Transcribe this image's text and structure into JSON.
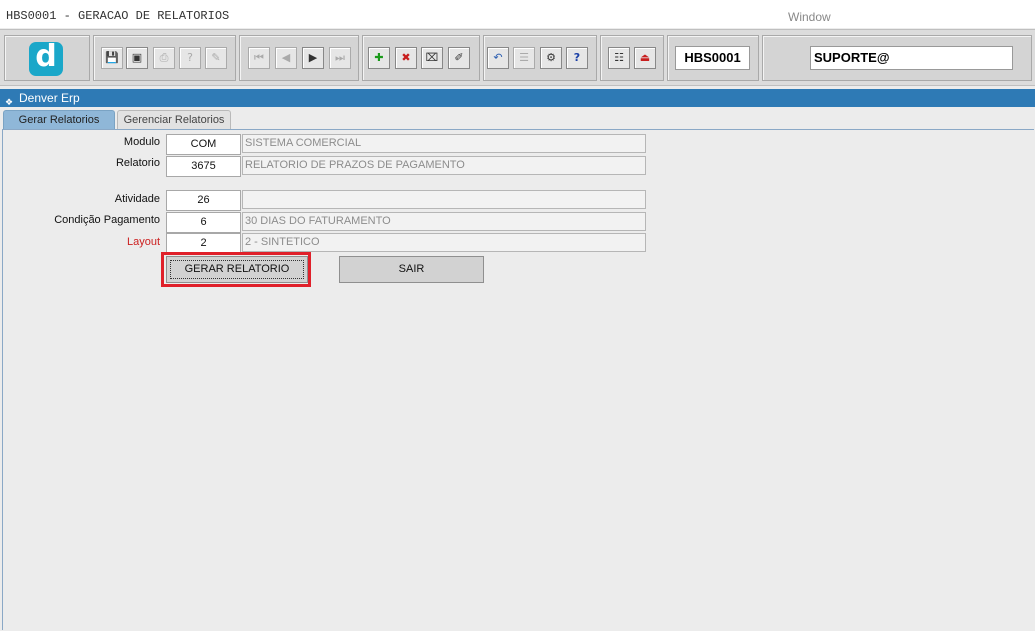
{
  "menubar": {
    "app_title": "HBS0001 - GERACAO DE RELATORIOS",
    "window_menu": "Window"
  },
  "toolbar": {
    "logo_letter": "d",
    "buttons": [
      {
        "icon": "save-icon",
        "glyph": "💾"
      },
      {
        "icon": "print-preview-icon",
        "glyph": "▣"
      },
      {
        "icon": "print-icon",
        "glyph": "⎙"
      },
      {
        "icon": "query-icon",
        "glyph": "?"
      },
      {
        "icon": "execute-query-icon",
        "glyph": "✎"
      },
      {
        "icon": "first-record-icon",
        "glyph": "⏮"
      },
      {
        "icon": "previous-record-icon",
        "glyph": "◀"
      },
      {
        "icon": "next-record-icon",
        "glyph": "▶"
      },
      {
        "icon": "last-record-icon",
        "glyph": "⏭"
      },
      {
        "icon": "insert-record-icon",
        "glyph": "✚"
      },
      {
        "icon": "delete-record-icon",
        "glyph": "✖"
      },
      {
        "icon": "clear-icon",
        "glyph": "⌧"
      },
      {
        "icon": "edit-icon",
        "glyph": "✐"
      },
      {
        "icon": "undo-icon",
        "glyph": "↶"
      },
      {
        "icon": "list-icon",
        "glyph": "☰"
      },
      {
        "icon": "tools-icon",
        "glyph": "⚙"
      },
      {
        "icon": "help-icon",
        "glyph": "?"
      },
      {
        "icon": "menu-icon",
        "glyph": "☷"
      },
      {
        "icon": "exit-icon",
        "glyph": "⏏"
      }
    ],
    "form_code": "HBS0001",
    "user": "SUPORTE@"
  },
  "window": {
    "title": "Denver Erp"
  },
  "tabs": [
    {
      "label": "Gerar Relatorios",
      "active": true
    },
    {
      "label": "Gerenciar Relatorios",
      "active": false
    }
  ],
  "form": {
    "modulo": {
      "label": "Modulo",
      "code": "COM",
      "desc": "SISTEMA COMERCIAL"
    },
    "relatorio": {
      "label": "Relatorio",
      "code": "3675",
      "desc": "RELATORIO DE PRAZOS DE PAGAMENTO"
    },
    "atividade": {
      "label": "Atividade",
      "code": "26",
      "desc": ""
    },
    "condicao": {
      "label": "Condição Pagamento",
      "code": "6",
      "desc": "30 DIAS DO FATURAMENTO"
    },
    "layout": {
      "label": "Layout",
      "code": "2",
      "desc": "2 - SINTETICO"
    }
  },
  "actions": {
    "generate_label": "GERAR RELATORIO",
    "exit_label": "SAIR"
  },
  "colors": {
    "title_bar": "#2e7ab5",
    "active_tab": "#8fb7d8",
    "highlight": "#e0202a",
    "required_label": "#cc1f1f",
    "logo": "#1aa7c9"
  }
}
